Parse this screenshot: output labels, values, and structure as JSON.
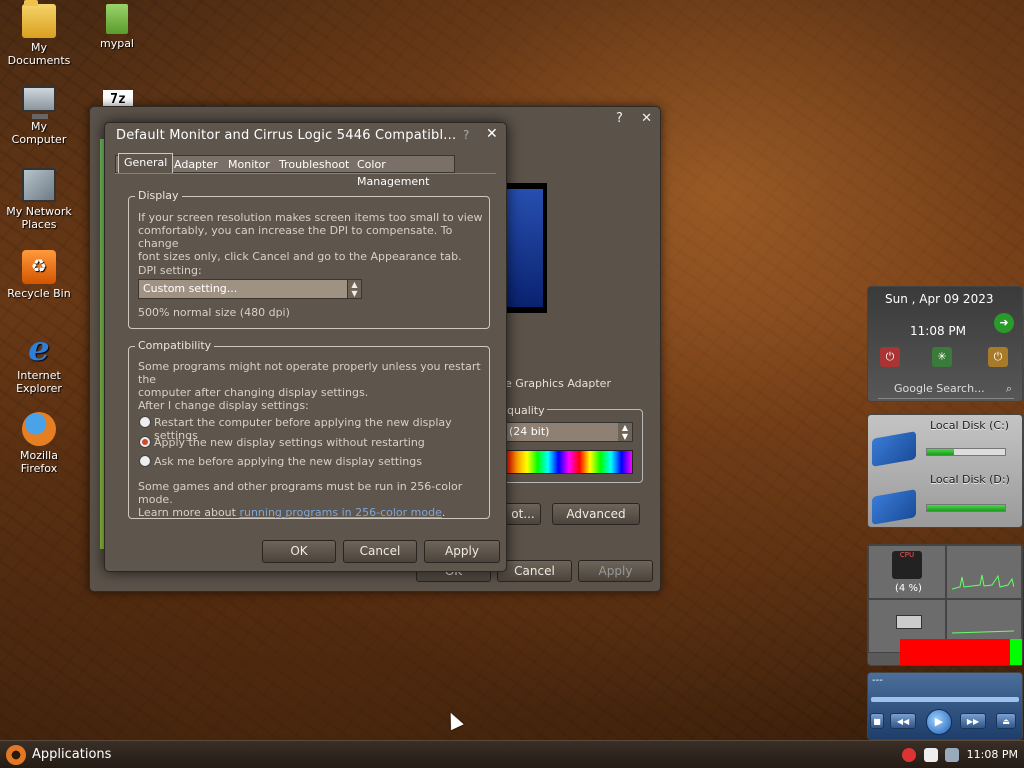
{
  "desktop": {
    "icons": [
      {
        "label": "My\nDocuments",
        "icon": "documents-folder-icon"
      },
      {
        "label": "mypal",
        "icon": "folder-icon"
      },
      {
        "label": "My\nComputer",
        "icon": "computer-icon"
      },
      {
        "label": "My Network\nPlaces",
        "icon": "network-places-icon"
      },
      {
        "label": "Recycle Bin",
        "icon": "recycle-bin-icon"
      },
      {
        "label": "Internet\nExplorer",
        "icon": "internet-explorer-icon"
      },
      {
        "label": "Mozilla\nFirefox",
        "icon": "firefox-icon"
      }
    ],
    "sevenzip_label": "7z"
  },
  "background_window": {
    "titlebar_help": "?",
    "titlebar_close": "✕",
    "adapter_text": "e Graphics Adapter",
    "quality_label": "quality",
    "quality_value": "(24 bit)",
    "troubleshoot_short": "ot...",
    "advanced": "Advanced",
    "ok": "OK",
    "cancel": "Cancel",
    "apply": "Apply"
  },
  "dialog": {
    "title": "Default Monitor and Cirrus Logic 5446 Compatibl...",
    "help": "?",
    "close": "✕",
    "tabs": [
      "General",
      "Adapter",
      "Monitor",
      "Troubleshoot",
      "Color Management"
    ],
    "active_tab": "General",
    "display_group": {
      "legend": "Display",
      "desc_lines": [
        "If your screen resolution makes screen items too small to view",
        "comfortably, you can increase the DPI to compensate.  To change",
        "font sizes only, click Cancel and go to the Appearance tab."
      ],
      "dpi_label": "DPI setting:",
      "dpi_value": "Custom setting...",
      "dpi_note": "500% normal size (480 dpi)"
    },
    "compat_group": {
      "legend": "Compatibility",
      "desc_lines": [
        "Some programs might not operate properly unless you restart the",
        "computer after changing display settings."
      ],
      "after_label": "After I change display settings:",
      "options": [
        "Restart the computer before applying the new display settings",
        "Apply the new display settings without restarting",
        "Ask me before applying the new display settings"
      ],
      "selected_option": 1,
      "note_line1": "Some games and other programs must be run in 256-color mode.",
      "note_prefix": "Learn more about ",
      "note_link": "running programs in 256-color mode",
      "note_suffix": "."
    },
    "buttons": {
      "ok": "OK",
      "cancel": "Cancel",
      "apply": "Apply"
    }
  },
  "gadgets": {
    "clock": {
      "date": "Sun , Apr 09 2023",
      "time": "11:08 PM"
    },
    "search": {
      "placeholder": "Google Search..."
    },
    "disks": [
      {
        "label": "Local Disk (C:)",
        "used_fraction": 0.35
      },
      {
        "label": "Local Disk (D:)",
        "used_fraction": 1.0
      }
    ],
    "cpu": {
      "label": "CPU",
      "percent": "(4 %)"
    },
    "media": {
      "title": "---"
    }
  },
  "taskbar": {
    "start_label": "Applications",
    "tray_time": "11:08 PM"
  },
  "colors": {
    "accent_orange": "#e27825",
    "disk_green": "#1c9a1c",
    "memory_bar_red": "#ff0000",
    "memory_bar_green": "#00ff00"
  }
}
